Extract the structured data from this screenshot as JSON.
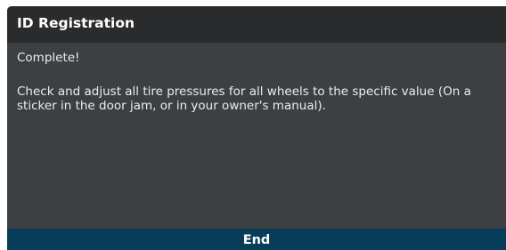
{
  "dialog": {
    "title": "ID Registration",
    "status": "Complete!",
    "message": "Check and adjust all tire pressures for all wheels to the specific value (On a sticker in the door jam, or in your owner's manual).",
    "end_label": "End"
  },
  "colors": {
    "title_bar": "#2a2b2c",
    "body": "#3d4043",
    "end_button": "#073d59",
    "text": "#ffffff"
  }
}
